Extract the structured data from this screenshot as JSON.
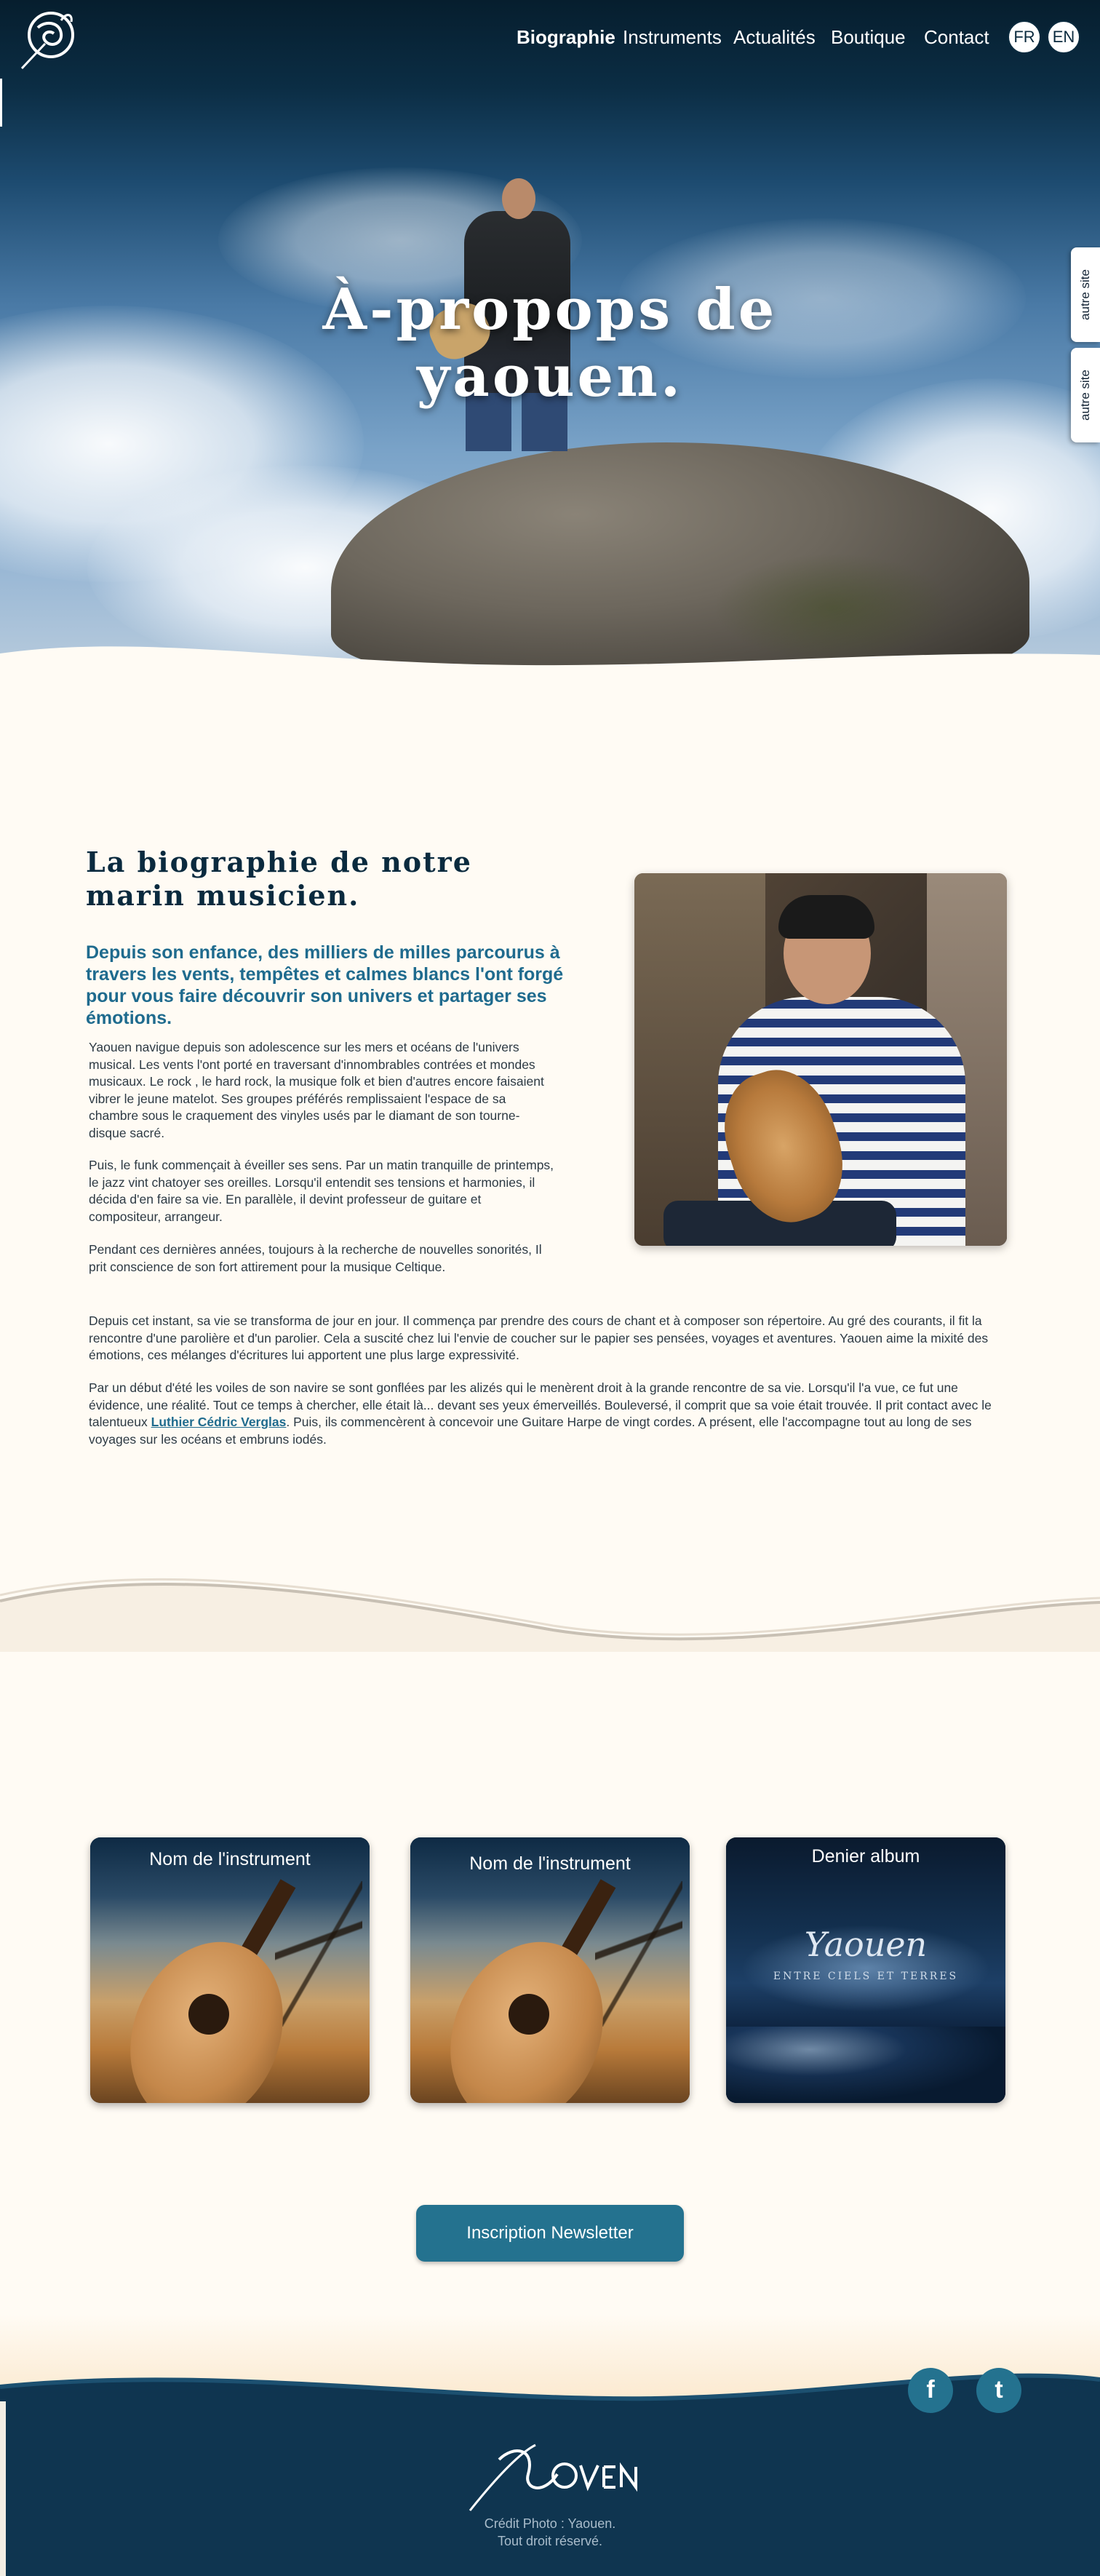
{
  "nav": {
    "items": [
      "Biographie",
      "Instruments",
      "Actualités",
      "Boutique",
      "Contact"
    ],
    "active": "Biographie",
    "lang": [
      "FR",
      "EN"
    ]
  },
  "side_tabs": [
    "autre site",
    "autre site"
  ],
  "hero": {
    "title_line1": "À-propops de",
    "title_line2": "yaouen."
  },
  "bio": {
    "title": "La biographie de notre marin musicien.",
    "lead": "Depuis son enfance, des milliers de milles parcourus à travers les vents, tempêtes et calmes blancs l'ont forgé pour vous faire découvrir son univers et partager ses émotions.",
    "p1": "Yaouen navigue depuis son adolescence sur les mers et océans de l'univers musical. Les vents l'ont porté en traversant d'innombrables contrées et mondes musicaux. Le rock , le hard rock, la musique folk et bien d'autres encore faisaient vibrer le jeune matelot. Ses groupes préférés remplissaient l'espace de sa chambre sous le craquement des vinyles usés par le diamant de son tourne-disque sacré.",
    "p2": "Puis, le  funk commençait à éveiller ses sens. Par un matin tranquille de printemps, le jazz vint chatoyer ses oreilles. Lorsqu'il entendit ses tensions et harmonies, il décida d'en faire sa vie. En parallèle, il devint professeur de guitare et compositeur, arrangeur.",
    "p3": "Pendant ces dernières années, toujours à la recherche de nouvelles sonorités, Il prit conscience de son fort attirement pour la musique Celtique.",
    "p4": "Depuis cet instant, sa vie se transforma de jour en jour. Il commença par prendre des cours de chant et à composer son répertoire. Au gré des courants, il fit la rencontre d'une parolière et d'un parolier. Cela a suscité chez lui l'envie de coucher sur le papier ses pensées, voyages et aventures. Yaouen aime la mixité des émotions, ces mélanges d'écritures lui apportent une plus large expressivité.",
    "p5_before": "Par un début d'été les voiles de son navire se sont gonflées par les alizés qui le menèrent droit à la grande rencontre de sa vie. Lorsqu'il l'a vue, ce fut une évidence, une réalité. Tout ce temps à chercher, elle était là... devant ses yeux émerveillés. Bouleversé, il comprit que sa voie était trouvée. Il prit contact avec le talentueux ",
    "p5_link": "Luthier Cédric Verglas",
    "p5_after": ". Puis, ils  commencèrent à concevoir une Guitare Harpe de vingt cordes. A  présent, elle l'accompagne tout au long de ses voyages sur les océans et embruns iodés."
  },
  "cards": [
    {
      "title": "Nom de l'instrument"
    },
    {
      "title": "Nom de l'instrument"
    },
    {
      "title": "Denier album",
      "logo": "Yaouen",
      "subtitle": "ENTRE CIELS ET TERRES"
    }
  ],
  "newsletter": {
    "label": "Inscription Newsletter"
  },
  "social": {
    "facebook": "f",
    "twitter": "t"
  },
  "footer": {
    "credit_line1": "Crédit Photo : Yaouen.",
    "credit_line2": "Tout droit réservé."
  },
  "colors": {
    "navy": "#0a2a3e",
    "accent": "#24728f",
    "cream": "#fffbf4"
  }
}
